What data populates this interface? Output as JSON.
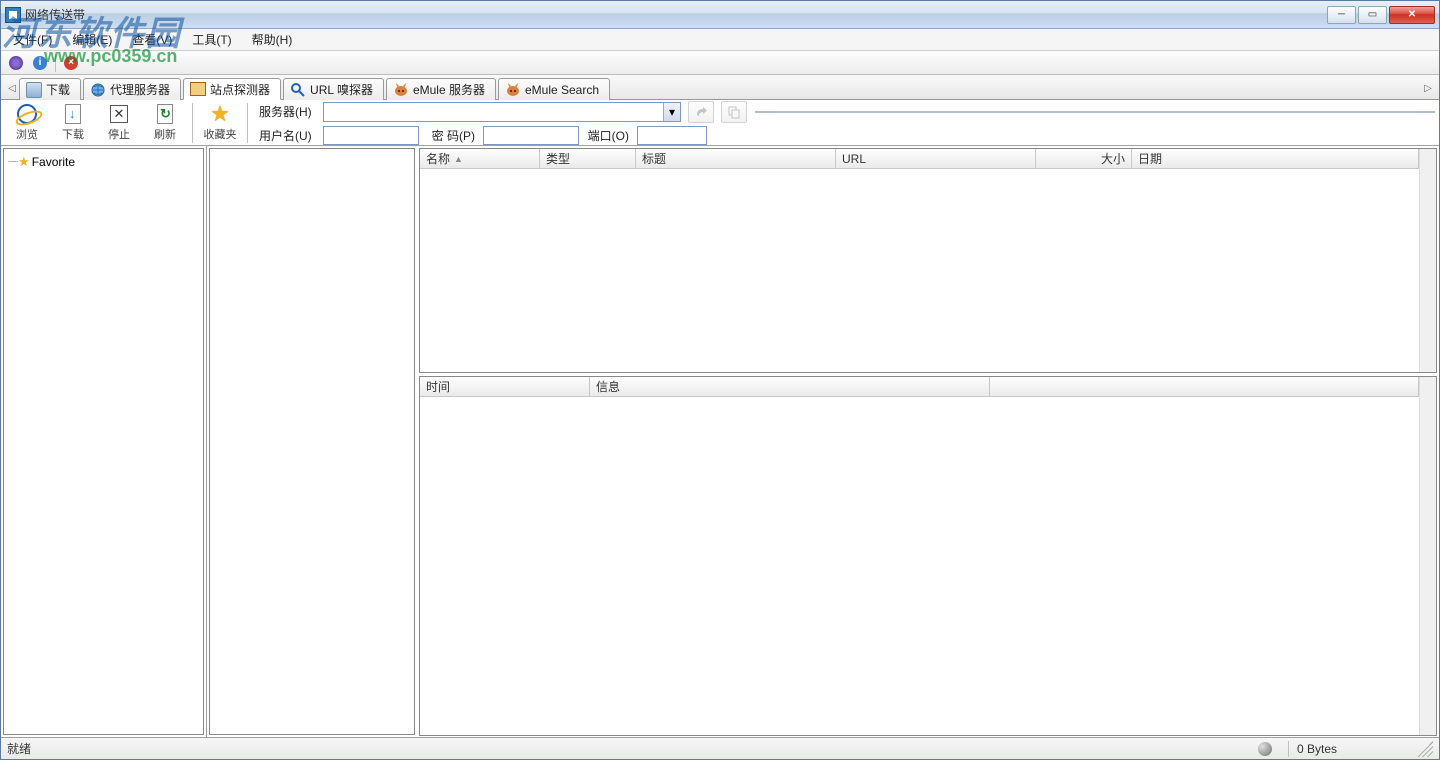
{
  "window": {
    "title": "网络传送带"
  },
  "menu": {
    "file": "文件(F)",
    "edit": "编辑(E)",
    "view": "查看(V)",
    "tools": "工具(T)",
    "help": "帮助(H)"
  },
  "watermark": {
    "text1": "河东软件园",
    "text2": "www.pc0359.cn"
  },
  "tabs": {
    "download": "下载",
    "proxy": "代理服务器",
    "site": "站点探测器",
    "url": "URL 嗅探器",
    "emule_server": "eMule 服务器",
    "emule_search": "eMule Search"
  },
  "toolbar": {
    "browse": "浏览",
    "download": "下载",
    "stop": "停止",
    "refresh": "刷新",
    "favorites": "收藏夹"
  },
  "form": {
    "server_label": "服务器(H)",
    "user_label": "用户名(U)",
    "pass_label": "密  码(P)",
    "port_label": "端口(O)",
    "server_value": "",
    "user_value": "",
    "pass_value": "",
    "port_value": ""
  },
  "tree": {
    "favorite": "Favorite"
  },
  "columns_upper": {
    "name": "名称",
    "type": "类型",
    "title": "标题",
    "url": "URL",
    "size": "大小",
    "date": "日期"
  },
  "columns_lower": {
    "time": "时间",
    "info": "信息"
  },
  "status": {
    "ready": "就绪",
    "bytes": "0 Bytes"
  }
}
